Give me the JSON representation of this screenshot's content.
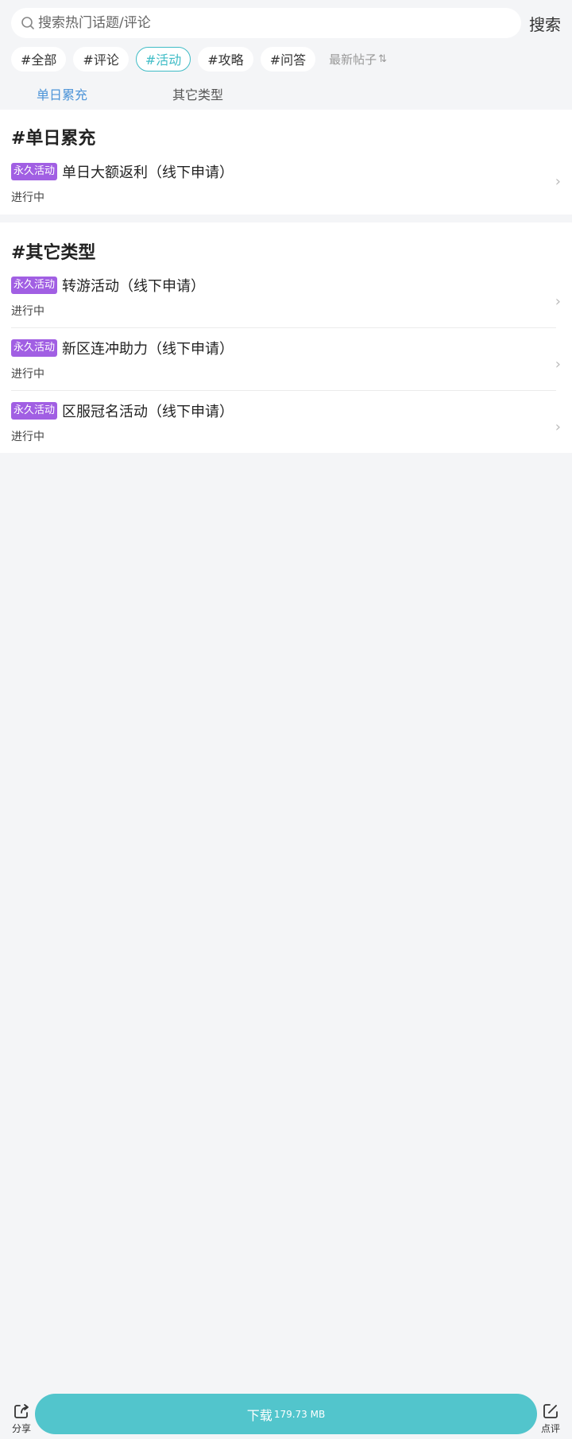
{
  "search": {
    "placeholder": "搜索热门话题/评论",
    "button_label": "搜索"
  },
  "tags": [
    {
      "label": "#全部",
      "active": false
    },
    {
      "label": "#评论",
      "active": false
    },
    {
      "label": "#活动",
      "active": true
    },
    {
      "label": "#攻略",
      "active": false
    },
    {
      "label": "#问答",
      "active": false
    }
  ],
  "sort": {
    "label": "最新帖子",
    "icon": "sort-arrows-icon"
  },
  "sub_tabs": [
    {
      "label": "单日累充",
      "active": true
    },
    {
      "label": "其它类型",
      "active": false
    }
  ],
  "sections": [
    {
      "title": "#单日累充",
      "items": [
        {
          "badge": "永久活动",
          "title": "单日大额返利（线下申请）",
          "status": "进行中"
        }
      ]
    },
    {
      "title": "#其它类型",
      "items": [
        {
          "badge": "永久活动",
          "title": "转游活动（线下申请）",
          "status": "进行中"
        },
        {
          "badge": "永久活动",
          "title": "新区连冲助力（线下申请）",
          "status": "进行中"
        },
        {
          "badge": "永久活动",
          "title": "区服冠名活动（线下申请）",
          "status": "进行中"
        }
      ]
    }
  ],
  "footer": {
    "share_label": "分享",
    "review_label": "点评",
    "download_label": "下载",
    "download_size": "179.73 MB"
  },
  "colors": {
    "accent": "#3fbcc6",
    "tab_active": "#4d94d8",
    "badge": "#a15fe3",
    "download": "#52c5cc"
  }
}
